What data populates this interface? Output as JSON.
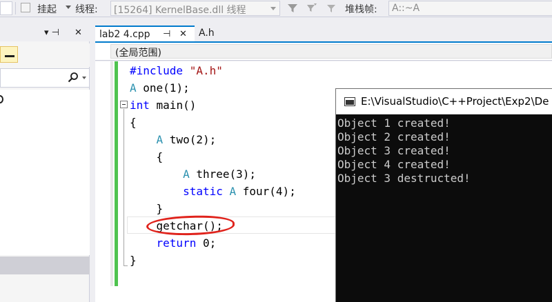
{
  "toolbar": {
    "suspend_label": "挂起",
    "thread_label": "线程:",
    "thread_value": "[15264] KernelBase.dll 线程",
    "stack_frame_label": "堆栈帧:",
    "stack_frame_value": "A::~A"
  },
  "left_panel": {
    "pin_glyph": "▾ ⊣",
    "close_glyph": "✕"
  },
  "tabs": [
    {
      "label": "lab2 4.cpp",
      "pin": "⊣",
      "close": "✕",
      "active": true
    },
    {
      "label": "A.h",
      "active": false
    }
  ],
  "scope": {
    "value": "(全局范围)"
  },
  "code": {
    "line1": {
      "kw": "#include",
      "str": " \"A.h\""
    },
    "line2": {
      "type": "A",
      "rest": " one(1);"
    },
    "line3": {
      "kw": "int",
      "rest": " main()"
    },
    "line4": "{",
    "line5": {
      "indent": "    ",
      "type": "A",
      "rest": " two(2);"
    },
    "line6": "    {",
    "line7": {
      "indent": "        ",
      "type": "A",
      "rest": " three(3);"
    },
    "line8": {
      "indent": "        ",
      "kw": "static",
      "type": " A",
      "rest": " four(4);"
    },
    "line9": "    }",
    "line10": "    getchar();",
    "line11": {
      "indent": "    ",
      "kw": "return",
      "rest": " 0;"
    },
    "line12": "}"
  },
  "console": {
    "title": "E:\\VisualStudio\\C++Project\\Exp2\\De",
    "lines": [
      "Object 1 created!",
      "Object 2 created!",
      "Object 3 created!",
      "Object 4 created!",
      "Object 3 destructed!"
    ]
  },
  "colors": {
    "accent": "#007acc",
    "change_bar": "#4fc34f",
    "annotation": "#e0231c",
    "keyword": "#0000ff",
    "string": "#a31515",
    "type": "#2b91af"
  }
}
